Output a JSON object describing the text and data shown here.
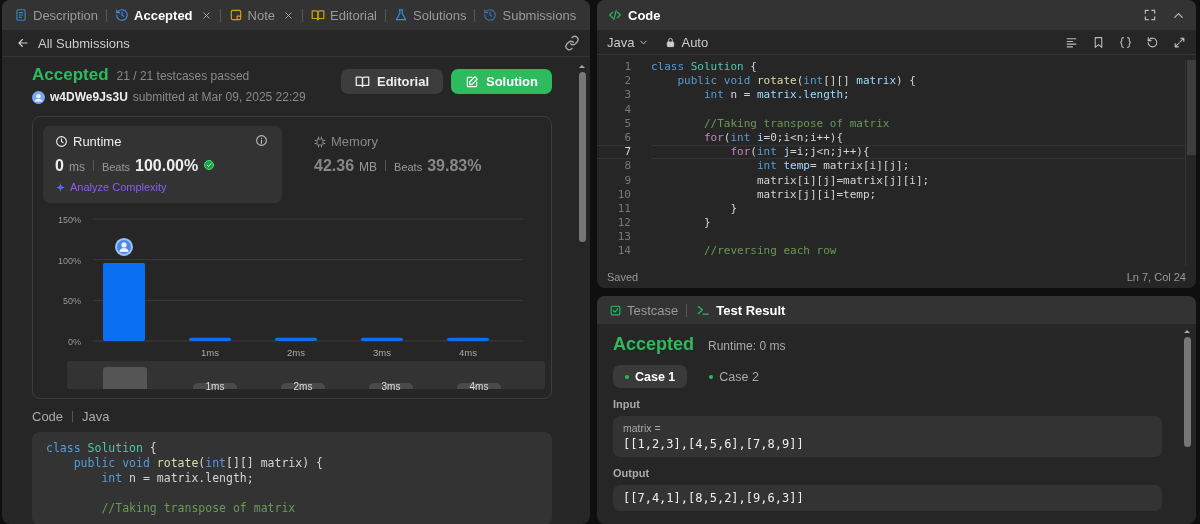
{
  "left_tabs": [
    {
      "label": "Description",
      "selected": false,
      "closable": false
    },
    {
      "label": "Accepted",
      "selected": true,
      "closable": true
    },
    {
      "label": "Note",
      "selected": false,
      "closable": true
    },
    {
      "label": "Editorial",
      "selected": false,
      "closable": false
    },
    {
      "label": "Solutions",
      "selected": false,
      "closable": false
    },
    {
      "label": "Submissions",
      "selected": false,
      "closable": false
    }
  ],
  "back_link": "All Submissions",
  "submission": {
    "status": "Accepted",
    "testcases": "21 / 21 testcases passed",
    "user": "w4DWe9Js3U",
    "submitted": "submitted at Mar 09, 2025 22:29",
    "buttons": [
      {
        "label": "Editorial",
        "kind": "secondary"
      },
      {
        "label": "Solution",
        "kind": "primary"
      }
    ],
    "stats": [
      {
        "title": "Runtime",
        "selected": true,
        "value": "0",
        "unit": "ms",
        "beats_label": "Beats",
        "beats": "100.00%",
        "link": "Analyze Complexity"
      },
      {
        "title": "Memory",
        "selected": false,
        "value": "42.36",
        "unit": "MB",
        "beats_label": "Beats",
        "beats": "39.83%"
      }
    ],
    "chart_data": {
      "type": "bar",
      "categories": [
        null,
        "1ms",
        "2ms",
        "3ms",
        "4ms"
      ],
      "values": [
        96,
        4,
        4,
        4,
        4
      ],
      "ylim": [
        0,
        150
      ],
      "yticks": [
        {
          "value": 0,
          "label": "0%"
        },
        {
          "value": 50,
          "label": "50%"
        },
        {
          "value": 100,
          "label": "100%"
        },
        {
          "value": 150,
          "label": "150%"
        }
      ]
    },
    "overview_labels": [
      "1ms",
      "2ms",
      "3ms",
      "4ms"
    ],
    "code_label": "Code",
    "code_language": "Java",
    "code_lines": [
      {
        "kind": "code",
        "tokens": [
          {
            "kind": "kw",
            "text": "class "
          },
          {
            "kind": "type",
            "text": "Solution"
          },
          {
            "kind": "p",
            "text": " {"
          }
        ]
      },
      {
        "kind": "code",
        "tokens": [
          {
            "kind": "kw",
            "text": "    public void "
          },
          {
            "kind": "fn",
            "text": "rotate"
          },
          {
            "kind": "p",
            "text": "("
          },
          {
            "kind": "kw",
            "text": "int"
          },
          {
            "kind": "p",
            "text": "[][] matrix) {"
          }
        ]
      },
      {
        "kind": "code",
        "tokens": [
          {
            "kind": "kw",
            "text": "        int "
          },
          {
            "kind": "p",
            "text": "n = matrix.length;"
          }
        ]
      },
      {
        "kind": "blank"
      },
      {
        "kind": "code",
        "tokens": [
          {
            "kind": "cm",
            "text": "        //Taking transpose of matrix"
          }
        ]
      }
    ]
  },
  "editor": {
    "title": "Code",
    "language": "Java",
    "mode": "Auto",
    "lines": [
      {
        "number": "1",
        "current": false,
        "tokens": [
          {
            "kind": "kw",
            "text": "class "
          },
          {
            "kind": "type",
            "text": "Solution"
          },
          {
            "kind": "p",
            "text": " {"
          }
        ]
      },
      {
        "number": "2",
        "current": false,
        "tokens": [
          {
            "kind": "kw",
            "text": "    public void "
          },
          {
            "kind": "fn",
            "text": "rotate"
          },
          {
            "kind": "p",
            "text": "("
          },
          {
            "kind": "kw",
            "text": "int"
          },
          {
            "kind": "p",
            "text": "[][] "
          },
          {
            "kind": "var",
            "text": "matrix"
          },
          {
            "kind": "p",
            "text": ") {"
          }
        ]
      },
      {
        "number": "3",
        "current": false,
        "tokens": [
          {
            "kind": "kw",
            "text": "        int "
          },
          {
            "kind": "p",
            "text": "n = "
          },
          {
            "kind": "var",
            "text": "matrix"
          },
          {
            "kind": "p",
            "text": "."
          },
          {
            "kind": "var",
            "text": "length"
          },
          {
            "kind": "p",
            "text": ";"
          }
        ]
      },
      {
        "number": "4",
        "current": false
      },
      {
        "number": "5",
        "current": false,
        "tokens": [
          {
            "kind": "cm",
            "text": "        //Taking transpose of matrix"
          }
        ]
      },
      {
        "number": "6",
        "current": false,
        "tokens": [
          {
            "kind": "ctl",
            "text": "        for"
          },
          {
            "kind": "p",
            "text": "("
          },
          {
            "kind": "kw",
            "text": "int "
          },
          {
            "kind": "var",
            "text": "i"
          },
          {
            "kind": "p",
            "text": "=0;i<n;i++){"
          }
        ]
      },
      {
        "number": "7",
        "current": true,
        "tokens": [
          {
            "kind": "ctl",
            "text": "            for"
          },
          {
            "kind": "p",
            "text": "("
          },
          {
            "kind": "kw",
            "text": "int "
          },
          {
            "kind": "var",
            "text": "j"
          },
          {
            "kind": "p",
            "text": "=i;j<n;j++){"
          }
        ]
      },
      {
        "number": "8",
        "current": false,
        "tokens": [
          {
            "kind": "kw",
            "text": "                int "
          },
          {
            "kind": "var",
            "text": "temp"
          },
          {
            "kind": "p",
            "text": "= matrix[i][j];"
          }
        ]
      },
      {
        "number": "9",
        "current": false,
        "tokens": [
          {
            "kind": "p",
            "text": "                matrix[i][j]=matrix[j][i];"
          }
        ]
      },
      {
        "number": "10",
        "current": false,
        "tokens": [
          {
            "kind": "p",
            "text": "                matrix[j][i]=temp;"
          }
        ]
      },
      {
        "number": "11",
        "current": false,
        "tokens": [
          {
            "kind": "p",
            "text": "            }"
          }
        ]
      },
      {
        "number": "12",
        "current": false,
        "tokens": [
          {
            "kind": "p",
            "text": "        }"
          }
        ]
      },
      {
        "number": "13",
        "current": false
      },
      {
        "number": "14",
        "current": false,
        "tokens": [
          {
            "kind": "cm",
            "text": "        //reversing each row"
          }
        ]
      }
    ],
    "status": "Saved",
    "cursor": "Ln 7, Col 24"
  },
  "result": {
    "tabs": [
      {
        "label": "Testcase",
        "selected": false
      },
      {
        "label": "Test Result",
        "selected": true
      }
    ],
    "status": "Accepted",
    "runtime": "Runtime: 0 ms",
    "cases": [
      {
        "label": "Case 1",
        "selected": true
      },
      {
        "label": "Case 2",
        "selected": false
      }
    ],
    "input_label": "Input",
    "param": "matrix =",
    "input": "[[1,2,3],[4,5,6],[7,8,9]]",
    "output_label": "Output",
    "output": "[[7,4,1],[8,5,2],[9,6,3]]"
  }
}
